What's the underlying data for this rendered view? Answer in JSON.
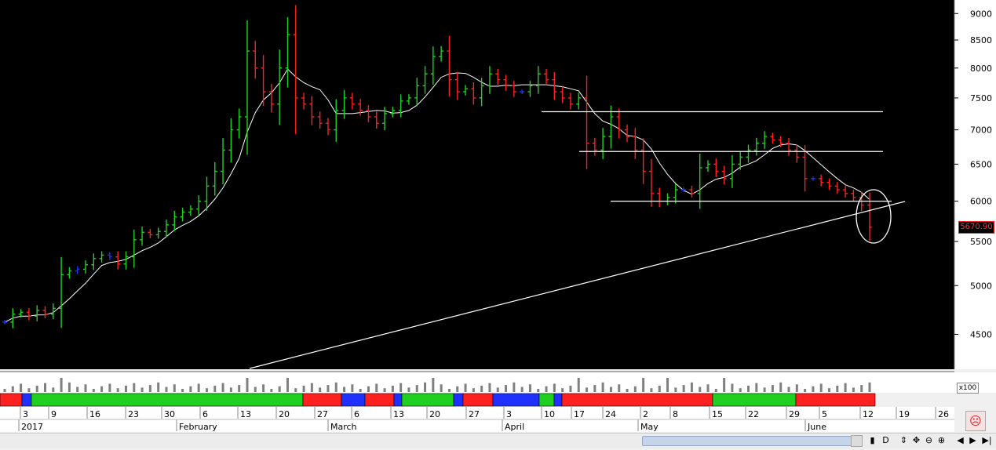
{
  "colors": {
    "background": "#000000",
    "up": "#20d020",
    "down": "#ff2020",
    "neutral": "#2030ff",
    "ma": "#ffffff",
    "volume": "#808080"
  },
  "price_tag": "5670.90",
  "volume_unit": "x100",
  "chart_data": {
    "type": "ohlc-bar",
    "yaxis": {
      "ticks": [
        "9000",
        "8500",
        "8000",
        "7500",
        "7000",
        "6500",
        "6000",
        "5500",
        "5000",
        "4500"
      ],
      "scale": "log",
      "ylim": [
        4180,
        9050
      ]
    },
    "x_day_labels": [
      "3",
      "9",
      "16",
      "23",
      "30",
      "6",
      "13",
      "20",
      "27",
      "6",
      "13",
      "20",
      "27",
      "3",
      "10",
      "17",
      "24",
      "2",
      "8",
      "15",
      "22",
      "29",
      "5",
      "12",
      "19",
      "26"
    ],
    "x_month_labels": [
      "2017",
      "February",
      "March",
      "April",
      "May",
      "June"
    ],
    "last_price": 5670.9,
    "bars_approx_close": [
      4620,
      4700,
      4720,
      4680,
      4740,
      4700,
      4760,
      5120,
      5160,
      5180,
      5230,
      5300,
      5340,
      5320,
      5240,
      5320,
      5520,
      5610,
      5580,
      5620,
      5700,
      5800,
      5860,
      5900,
      6000,
      6200,
      6400,
      6700,
      7000,
      7200,
      8300,
      8000,
      7600,
      7400,
      8000,
      8600,
      7500,
      7400,
      7200,
      7100,
      7000,
      7300,
      7500,
      7400,
      7300,
      7200,
      7100,
      7250,
      7300,
      7450,
      7500,
      7700,
      7900,
      8200,
      8300,
      7800,
      7600,
      7650,
      7500,
      7700,
      7900,
      7800,
      7700,
      7600,
      7600,
      7700,
      7900,
      7800,
      7600,
      7500,
      7400,
      7500,
      6800,
      6700,
      6900,
      7200,
      7000,
      6900,
      6700,
      6400,
      6100,
      6000,
      6050,
      6150,
      6150,
      6100,
      6450,
      6500,
      6400,
      6300,
      6500,
      6600,
      6700,
      6800,
      6900,
      6850,
      6800,
      6700,
      6600,
      6300,
      6300,
      6250,
      6200,
      6150,
      6100,
      6050,
      5950,
      5671
    ],
    "moving_average": "single white line",
    "trend_lines": [
      "horizontal ~7280",
      "horizontal ~6680",
      "horizontal ~6000",
      "rising support line"
    ],
    "annotation": "circle around last bars"
  }
}
